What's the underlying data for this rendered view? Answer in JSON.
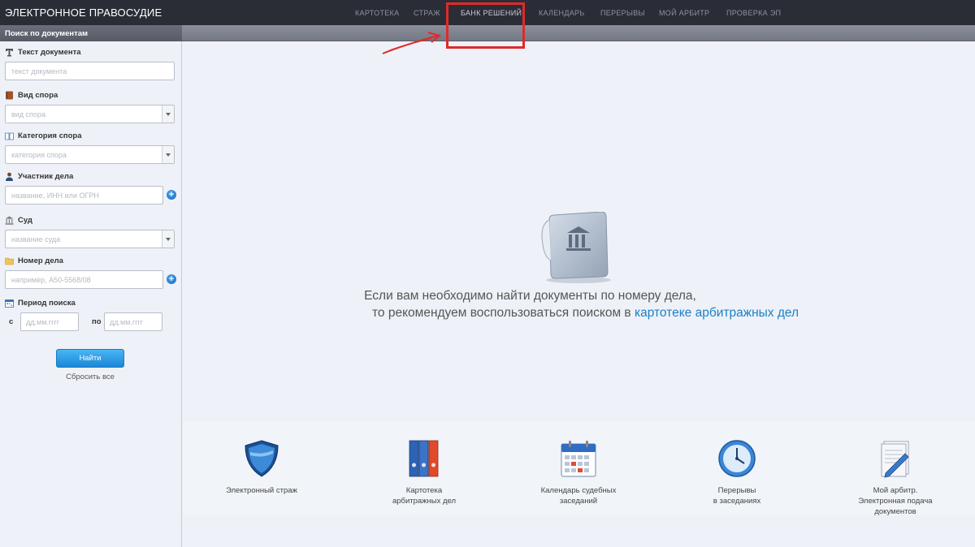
{
  "header": {
    "brand": "ЭЛЕКТРОННОЕ ПРАВОСУДИЕ",
    "nav": [
      {
        "label": "КАРТОТЕКА"
      },
      {
        "label": "СТРАЖ"
      },
      {
        "label": "БАНК РЕШЕНИЙ",
        "active": true
      },
      {
        "label": "КАЛЕНДАРЬ"
      },
      {
        "label": "ПЕРЕРЫВЫ"
      },
      {
        "label": "МОЙ АРБИТР"
      },
      {
        "label": "ПРОВЕРКА ЭП"
      }
    ]
  },
  "sidebar": {
    "title": "Поиск по документам",
    "fields": {
      "text": {
        "label": "Текст документа",
        "placeholder": "текст документа",
        "icon": "text-icon"
      },
      "dispute_type": {
        "label": "Вид спора",
        "placeholder": "вид спора",
        "icon": "book-icon"
      },
      "dispute_category": {
        "label": "Категория спора",
        "placeholder": "категория спора",
        "icon": "open-book-icon"
      },
      "participant": {
        "label": "Участник дела",
        "placeholder": "название, ИНН или ОГРН",
        "icon": "person-icon"
      },
      "court": {
        "label": "Суд",
        "placeholder": "название суда",
        "icon": "court-building-icon"
      },
      "case_number": {
        "label": "Номер дела",
        "placeholder": "например, А50-5568/08",
        "icon": "folder-icon"
      },
      "period": {
        "label": "Период поиска",
        "icon": "calendar-icon",
        "from_label": "с",
        "to_label": "по",
        "from_placeholder": "дд.мм.гггг",
        "to_placeholder": "дд.мм.гггг"
      }
    },
    "find_button": "Найти",
    "reset_link": "Сбросить все"
  },
  "main": {
    "hint_line1": "Если вам необходимо найти документы по номеру дела,",
    "hint_line2_prefix": "то рекомендуем воспользоваться поиском в ",
    "hint_link": "картотеке арбитражных дел",
    "tiles": [
      {
        "label": "Электронный страж",
        "icon": "shield-icon"
      },
      {
        "label_lines": [
          "Картотека",
          "арбитражных дел"
        ],
        "icon": "binders-icon"
      },
      {
        "label_lines": [
          "Календарь судебных",
          "заседаний"
        ],
        "icon": "calendar-icon"
      },
      {
        "label_lines": [
          "Перерывы",
          "в заседаниях"
        ],
        "icon": "clock-icon"
      },
      {
        "label_lines": [
          "Мой арбитр.",
          "Электронная подача",
          "документов"
        ],
        "icon": "document-pen-icon"
      }
    ]
  },
  "colors": {
    "topbar": "#2a2d36",
    "accent_blue": "#1a7fc7",
    "button_blue": "#2a95e0",
    "annotation_red": "#e02a2a"
  }
}
